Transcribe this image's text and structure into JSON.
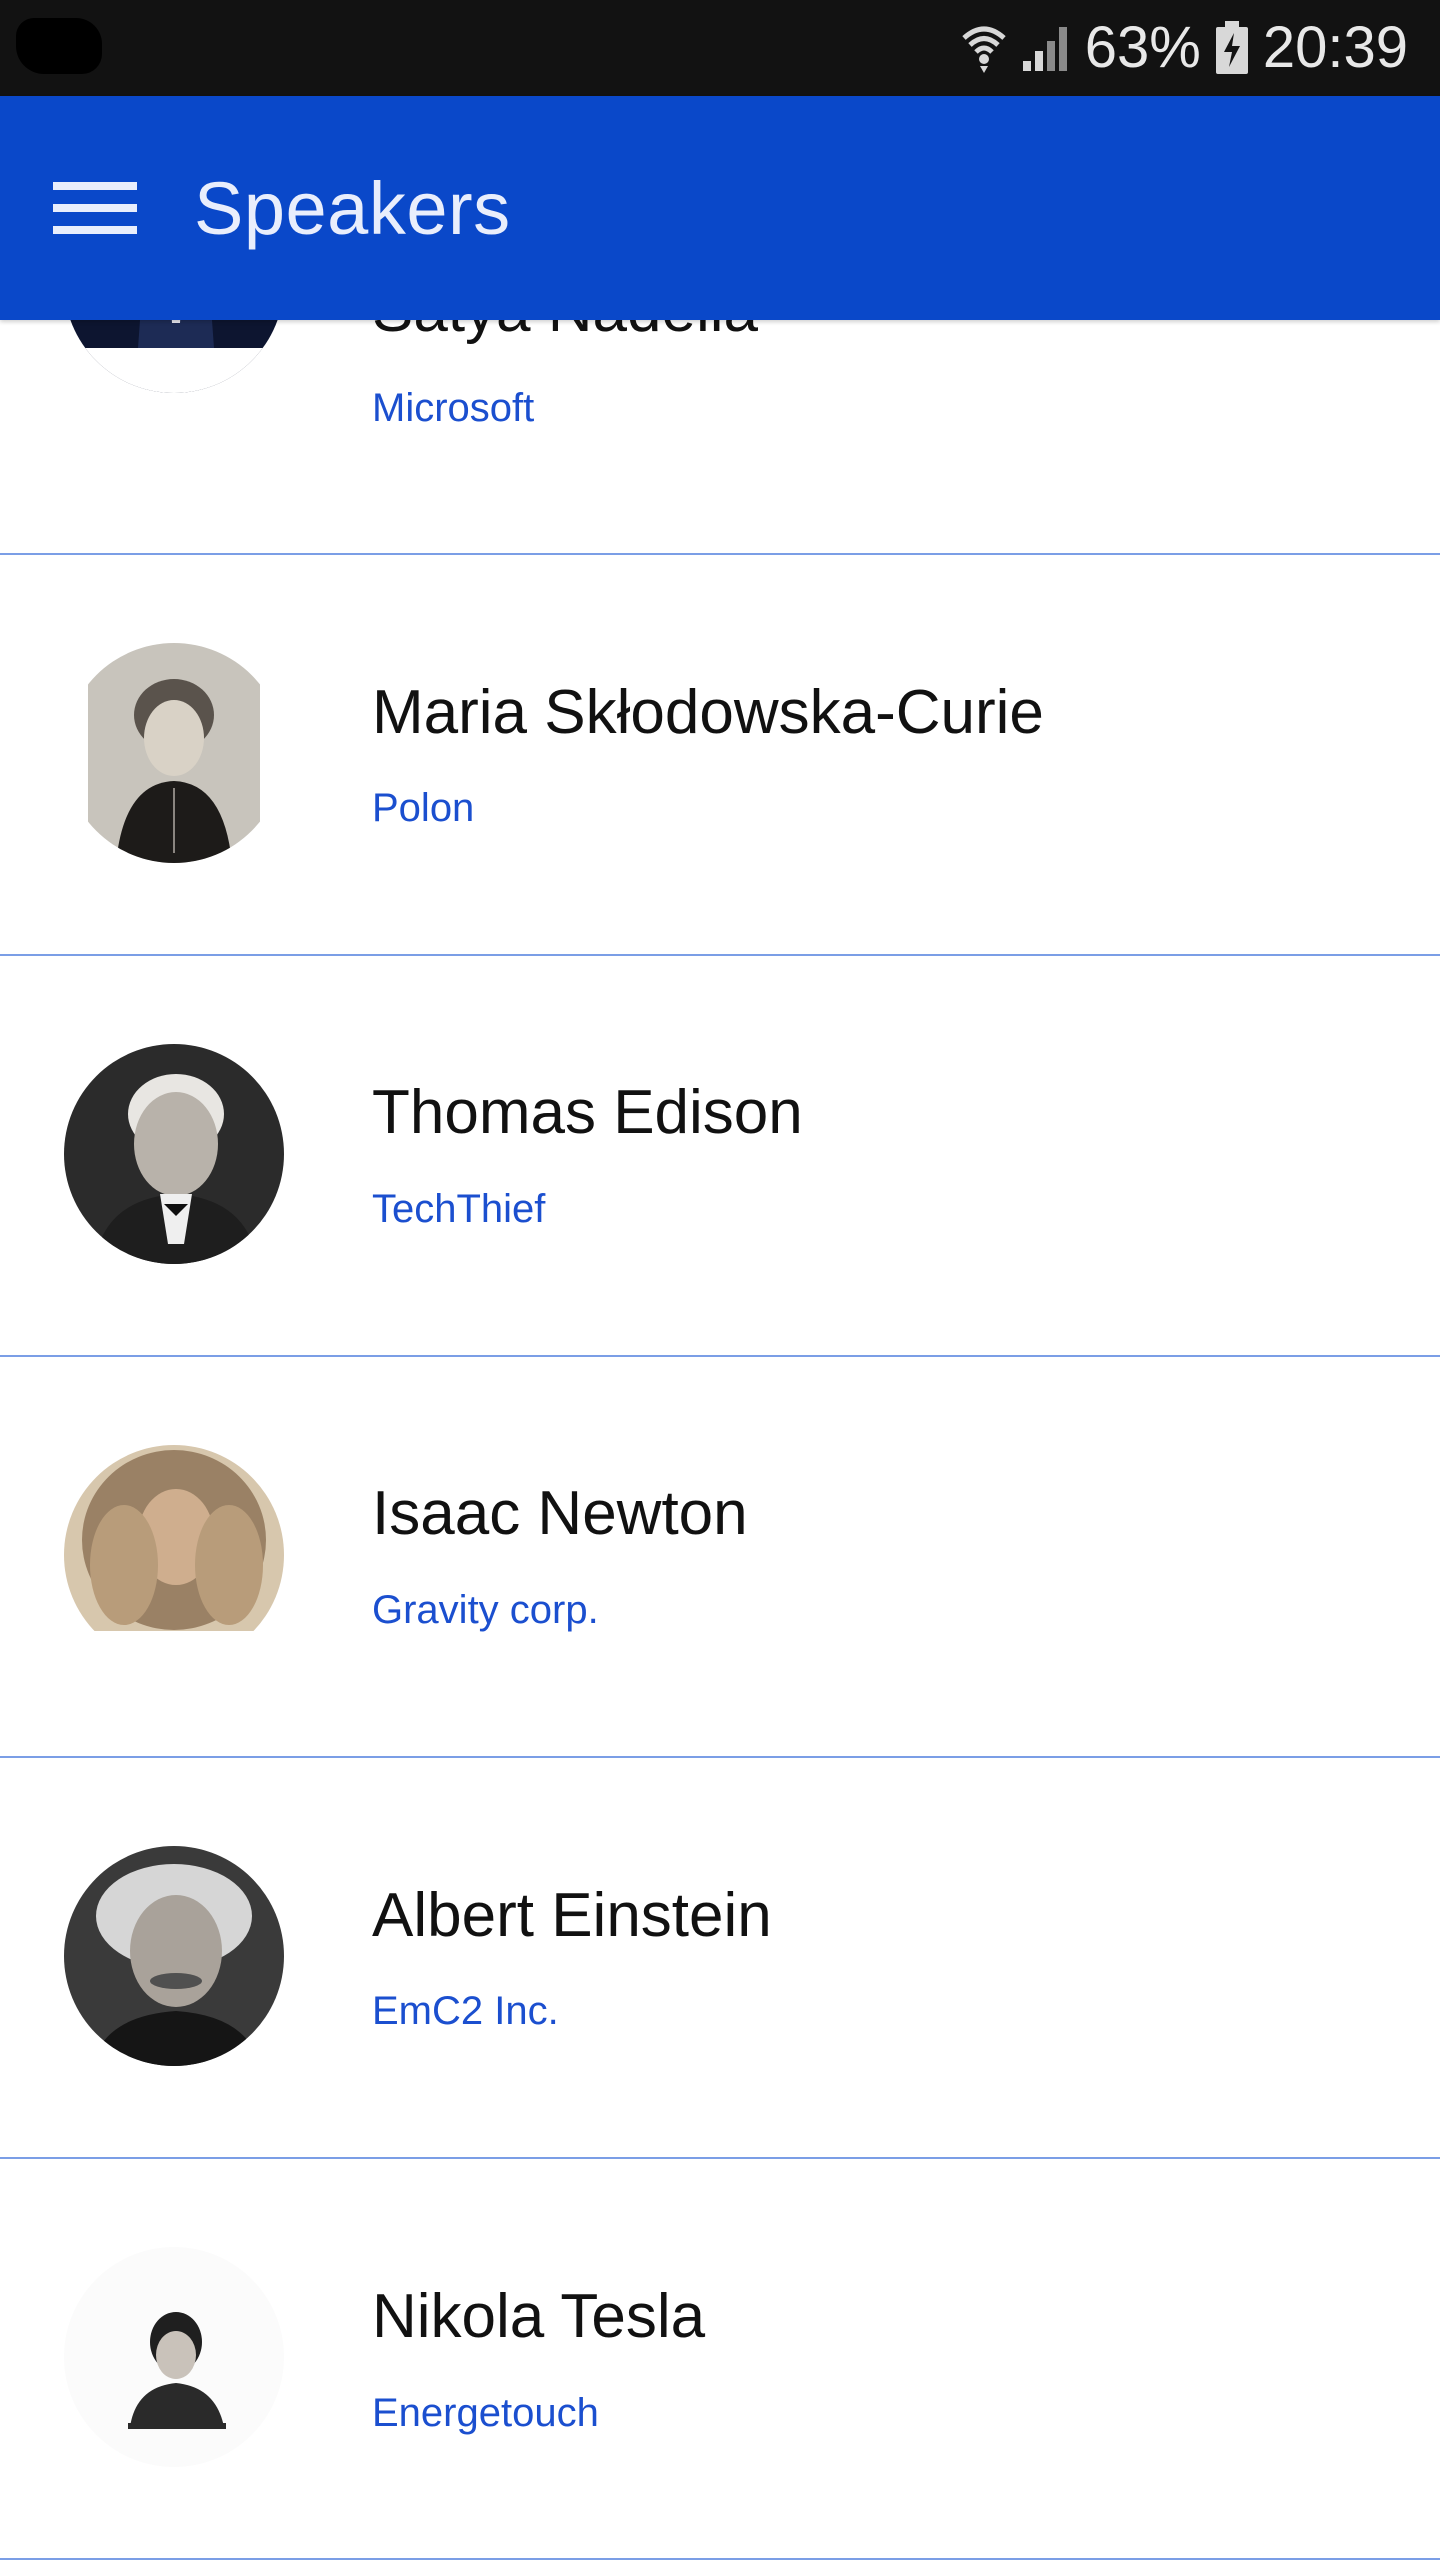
{
  "status_bar": {
    "battery": "63%",
    "time": "20:39",
    "icons": [
      "wifi-icon",
      "signal-icon",
      "battery-charging-icon"
    ]
  },
  "app_bar": {
    "title": "Speakers",
    "menu_icon": "hamburger-menu-icon",
    "background": "#0a48c9"
  },
  "speakers": [
    {
      "name": "Satya Nadella",
      "company": "Microsoft"
    },
    {
      "name": "Maria Skłodowska-Curie",
      "company": "Polon"
    },
    {
      "name": "Thomas Edison",
      "company": "TechThief"
    },
    {
      "name": "Isaac Newton",
      "company": "Gravity corp."
    },
    {
      "name": "Albert Einstein",
      "company": "EmC2 Inc."
    },
    {
      "name": "Nikola Tesla",
      "company": "Energetouch"
    }
  ],
  "colors": {
    "accent": "#0a48c9",
    "company_text": "#1b4fcf",
    "divider": "#7b9ee6"
  }
}
